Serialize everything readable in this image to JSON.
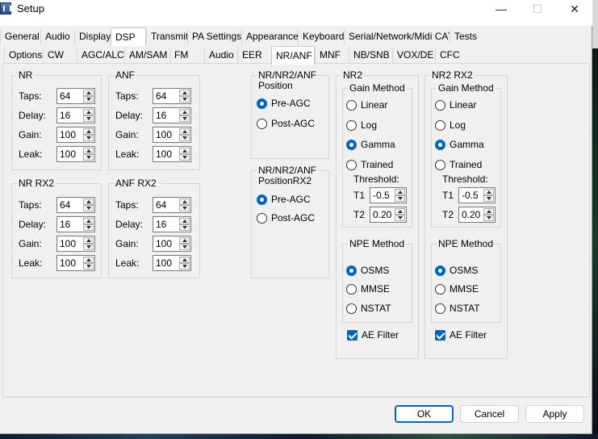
{
  "window": {
    "title": "Setup",
    "minimize": "—",
    "maximize": "☐",
    "close": "✕"
  },
  "tabs_main": [
    "General",
    "Audio",
    "Display",
    "DSP",
    "Transmit",
    "PA Settings",
    "Appearance",
    "Keyboard",
    "Serial/Network/Midi CAT",
    "Tests"
  ],
  "tabs_sub": [
    "Options",
    "CW",
    "AGC/ALC",
    "AM/SAM",
    "FM",
    "Audio",
    "EER",
    "NR/ANF",
    "MNF",
    "NB/SNB",
    "VOX/DE",
    "CFC"
  ],
  "nr": {
    "title": "NR",
    "taps_label": "Taps:",
    "taps": "64",
    "delay_label": "Delay:",
    "delay": "16",
    "gain_label": "Gain:",
    "gain": "100",
    "leak_label": "Leak:",
    "leak": "100"
  },
  "anf": {
    "title": "ANF",
    "taps_label": "Taps:",
    "taps": "64",
    "delay_label": "Delay:",
    "delay": "16",
    "gain_label": "Gain:",
    "gain": "100",
    "leak_label": "Leak:",
    "leak": "100"
  },
  "nr_rx2": {
    "title": "NR RX2",
    "taps_label": "Taps:",
    "taps": "64",
    "delay_label": "Delay:",
    "delay": "16",
    "gain_label": "Gain:",
    "gain": "100",
    "leak_label": "Leak:",
    "leak": "100"
  },
  "anf_rx2": {
    "title": "ANF RX2",
    "taps_label": "Taps:",
    "taps": "64",
    "delay_label": "Delay:",
    "delay": "16",
    "gain_label": "Gain:",
    "gain": "100",
    "leak_label": "Leak:",
    "leak": "100"
  },
  "position": {
    "title_line1": "NR/NR2/ANF",
    "title_line2": "Position",
    "pre_agc": "Pre-AGC",
    "post_agc": "Post-AGC",
    "selected": "Pre-AGC"
  },
  "position_rx2": {
    "title_line1": "NR/NR2/ANF",
    "title_line2": "PositionRX2",
    "pre_agc": "Pre-AGC",
    "post_agc": "Post-AGC",
    "selected": "Pre-AGC"
  },
  "nr2": {
    "title": "NR2",
    "gain_method_title": "Gain Method",
    "linear": "Linear",
    "log": "Log",
    "gamma": "Gamma",
    "trained": "Trained",
    "gain_selected": "Gamma",
    "threshold_label": "Threshold:",
    "t1_label": "T1",
    "t1": "-0.5",
    "t2_label": "T2",
    "t2": "0.20",
    "npe_title": "NPE Method",
    "osms": "OSMS",
    "mmse": "MMSE",
    "nstat": "NSTAT",
    "npe_selected": "OSMS",
    "ae_filter": "AE Filter",
    "ae_checked": true
  },
  "nr2_rx2": {
    "title": "NR2 RX2",
    "gain_method_title": "Gain Method",
    "linear": "Linear",
    "log": "Log",
    "gamma": "Gamma",
    "trained": "Trained",
    "gain_selected": "Gamma",
    "threshold_label": "Threshold:",
    "t1_label": "T1",
    "t1": "-0.5",
    "t2_label": "T2",
    "t2": "0.20",
    "npe_title": "NPE Method",
    "osms": "OSMS",
    "mmse": "MMSE",
    "nstat": "NSTAT",
    "npe_selected": "OSMS",
    "ae_filter": "AE Filter",
    "ae_checked": true
  },
  "buttons": {
    "ok": "OK",
    "cancel": "Cancel",
    "apply": "Apply"
  },
  "colors": {
    "accent": "#0067c0",
    "window_bg": "#f0f0f0"
  }
}
